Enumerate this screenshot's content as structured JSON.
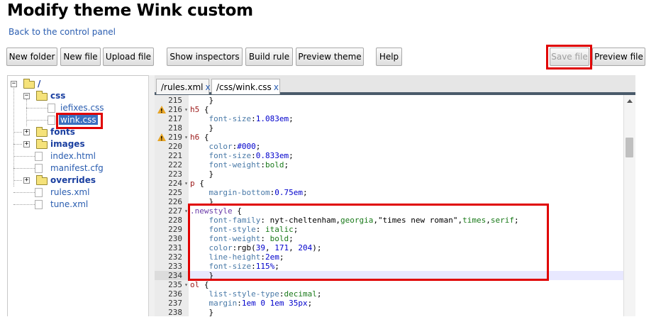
{
  "page": {
    "title": "Modify theme Wink custom",
    "back_link": "Back to the control panel"
  },
  "toolbar": {
    "new_folder": "New folder",
    "new_file": "New file",
    "upload_file": "Upload file",
    "show_inspectors": "Show inspectors",
    "build_rule": "Build rule",
    "preview_theme": "Preview theme",
    "help": "Help",
    "save_file": "Save file",
    "preview_file": "Preview file"
  },
  "tree": {
    "root": "/",
    "css": "css",
    "iefixes": "iefixes.css",
    "wink": "wink.css",
    "fonts": "fonts",
    "images": "images",
    "index": "index.html",
    "manifest": "manifest.cfg",
    "overrides": "overrides",
    "rules": "rules.xml",
    "tune": "tune.xml",
    "expander_open": "−",
    "expander_closed": "+"
  },
  "tabs": [
    {
      "label": "/rules.xml",
      "close": "x"
    },
    {
      "label": "/css/wink.css",
      "close": "x"
    }
  ],
  "colors": {
    "highlight": "#e00000",
    "link": "#2a5db0",
    "tabbar_border": "#4a5a6a"
  },
  "code_lines": [
    {
      "num": "215",
      "fold": "",
      "warn": false,
      "parts": [
        [
          "pun",
          "    }"
        ]
      ]
    },
    {
      "num": "216",
      "fold": "▾",
      "warn": true,
      "parts": [
        [
          "sel",
          "h5"
        ],
        [
          "pun",
          " {"
        ]
      ]
    },
    {
      "num": "217",
      "fold": "",
      "warn": false,
      "parts": [
        [
          "pun",
          "    "
        ],
        [
          "prop",
          "font-size"
        ],
        [
          "pun",
          ":"
        ],
        [
          "num",
          "1.083em"
        ],
        [
          "pun",
          ";"
        ]
      ]
    },
    {
      "num": "218",
      "fold": "",
      "warn": false,
      "parts": [
        [
          "pun",
          "    }"
        ]
      ]
    },
    {
      "num": "219",
      "fold": "▾",
      "warn": true,
      "parts": [
        [
          "sel",
          "h6"
        ],
        [
          "pun",
          " {"
        ]
      ]
    },
    {
      "num": "220",
      "fold": "",
      "warn": false,
      "parts": [
        [
          "pun",
          "    "
        ],
        [
          "prop",
          "color"
        ],
        [
          "pun",
          ":"
        ],
        [
          "num",
          "#000"
        ],
        [
          "pun",
          ";"
        ]
      ]
    },
    {
      "num": "221",
      "fold": "",
      "warn": false,
      "parts": [
        [
          "pun",
          "    "
        ],
        [
          "prop",
          "font-size"
        ],
        [
          "pun",
          ":"
        ],
        [
          "num",
          "0.833em"
        ],
        [
          "pun",
          ";"
        ]
      ]
    },
    {
      "num": "222",
      "fold": "",
      "warn": false,
      "parts": [
        [
          "pun",
          "    "
        ],
        [
          "prop",
          "font-weight"
        ],
        [
          "pun",
          ":"
        ],
        [
          "val",
          "bold"
        ],
        [
          "pun",
          ";"
        ]
      ]
    },
    {
      "num": "223",
      "fold": "",
      "warn": false,
      "parts": [
        [
          "pun",
          "    }"
        ]
      ]
    },
    {
      "num": "224",
      "fold": "▾",
      "warn": false,
      "parts": [
        [
          "sel",
          "p"
        ],
        [
          "pun",
          " {"
        ]
      ]
    },
    {
      "num": "225",
      "fold": "",
      "warn": false,
      "parts": [
        [
          "pun",
          "    "
        ],
        [
          "prop",
          "margin-bottom"
        ],
        [
          "pun",
          ":"
        ],
        [
          "num",
          "0.75em"
        ],
        [
          "pun",
          ";"
        ]
      ]
    },
    {
      "num": "226",
      "fold": "",
      "warn": false,
      "parts": [
        [
          "pun",
          "    }"
        ]
      ]
    },
    {
      "num": "227",
      "fold": "▾",
      "warn": false,
      "parts": [
        [
          "cls",
          ".newstyle"
        ],
        [
          "pun",
          " {"
        ]
      ]
    },
    {
      "num": "228",
      "fold": "",
      "warn": false,
      "parts": [
        [
          "pun",
          "    "
        ],
        [
          "prop",
          "font-family"
        ],
        [
          "pun",
          ": "
        ],
        [
          "pun",
          "nyt-cheltenham,"
        ],
        [
          "val",
          "georgia"
        ],
        [
          "pun",
          ","
        ],
        [
          "pun",
          "\"times new roman\""
        ],
        [
          "pun",
          ","
        ],
        [
          "val",
          "times"
        ],
        [
          "pun",
          ","
        ],
        [
          "val",
          "serif"
        ],
        [
          "pun",
          ";"
        ]
      ]
    },
    {
      "num": "229",
      "fold": "",
      "warn": false,
      "parts": [
        [
          "pun",
          "    "
        ],
        [
          "prop",
          "font-style"
        ],
        [
          "pun",
          ": "
        ],
        [
          "val",
          "italic"
        ],
        [
          "pun",
          ";"
        ]
      ]
    },
    {
      "num": "230",
      "fold": "",
      "warn": false,
      "parts": [
        [
          "pun",
          "    "
        ],
        [
          "prop",
          "font-weight"
        ],
        [
          "pun",
          ": "
        ],
        [
          "val",
          "bold"
        ],
        [
          "pun",
          ";"
        ]
      ]
    },
    {
      "num": "231",
      "fold": "",
      "warn": false,
      "parts": [
        [
          "pun",
          "    "
        ],
        [
          "prop",
          "color"
        ],
        [
          "pun",
          ":"
        ],
        [
          "pun",
          "rgb("
        ],
        [
          "num",
          "39"
        ],
        [
          "pun",
          ", "
        ],
        [
          "num",
          "171"
        ],
        [
          "pun",
          ", "
        ],
        [
          "num",
          "204"
        ],
        [
          "pun",
          ");"
        ]
      ]
    },
    {
      "num": "232",
      "fold": "",
      "warn": false,
      "parts": [
        [
          "pun",
          "    "
        ],
        [
          "prop",
          "line-height"
        ],
        [
          "pun",
          ":"
        ],
        [
          "num",
          "2em"
        ],
        [
          "pun",
          ";"
        ]
      ]
    },
    {
      "num": "233",
      "fold": "",
      "warn": false,
      "parts": [
        [
          "pun",
          "    "
        ],
        [
          "prop",
          "font-size"
        ],
        [
          "pun",
          ":"
        ],
        [
          "num",
          "115%"
        ],
        [
          "pun",
          ";"
        ]
      ]
    },
    {
      "num": "234",
      "fold": "",
      "warn": false,
      "active": true,
      "parts": [
        [
          "pun",
          "    }"
        ]
      ]
    },
    {
      "num": "235",
      "fold": "▾",
      "warn": false,
      "parts": [
        [
          "sel",
          "ol"
        ],
        [
          "pun",
          " {"
        ]
      ]
    },
    {
      "num": "236",
      "fold": "",
      "warn": false,
      "parts": [
        [
          "pun",
          "    "
        ],
        [
          "prop",
          "list-style-type"
        ],
        [
          "pun",
          ":"
        ],
        [
          "val",
          "decimal"
        ],
        [
          "pun",
          ";"
        ]
      ]
    },
    {
      "num": "237",
      "fold": "",
      "warn": false,
      "parts": [
        [
          "pun",
          "    "
        ],
        [
          "prop",
          "margin"
        ],
        [
          "pun",
          ":"
        ],
        [
          "num",
          "1em"
        ],
        [
          "pun",
          " "
        ],
        [
          "num",
          "0"
        ],
        [
          "pun",
          " "
        ],
        [
          "num",
          "1em"
        ],
        [
          "pun",
          " "
        ],
        [
          "num",
          "35px"
        ],
        [
          "pun",
          ";"
        ]
      ]
    },
    {
      "num": "238",
      "fold": "",
      "warn": false,
      "parts": [
        [
          "pun",
          "    }"
        ]
      ]
    }
  ]
}
